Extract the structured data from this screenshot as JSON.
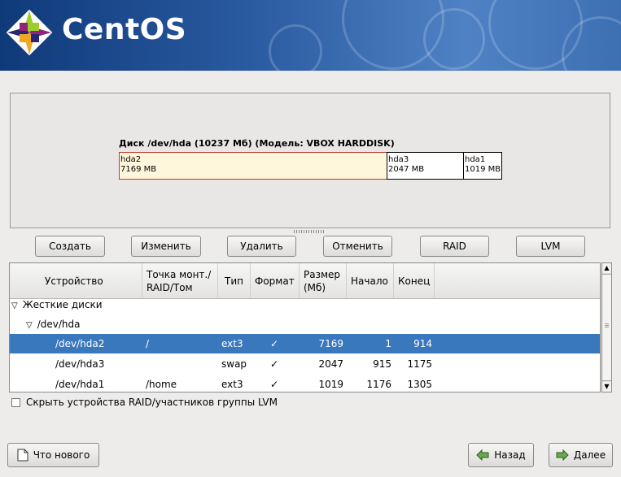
{
  "header": {
    "brand": "CentOS"
  },
  "disk": {
    "title": "Диск /dev/hda (10237 Мб) (Модель: VBOX HARDDISK)",
    "segments": [
      {
        "name": "hda2",
        "size": "7169 MB"
      },
      {
        "name": "hda3",
        "size": "2047 MB"
      },
      {
        "name": "hda1",
        "size": "1019 MB"
      }
    ]
  },
  "actions": {
    "create": "Создать",
    "edit": "Изменить",
    "delete": "Удалить",
    "cancel": "Отменить",
    "raid": "RAID",
    "lvm": "LVM"
  },
  "table": {
    "columns": {
      "device": "Устройство",
      "mount_line1": "Точка монт./",
      "mount_line2": "RAID/Том",
      "type": "Тип",
      "format": "Формат",
      "size_line1": "Размер",
      "size_line2": "(Мб)",
      "start": "Начало",
      "end": "Конец"
    },
    "group": "Жесткие диски",
    "disk": "/dev/hda",
    "rows": [
      {
        "device": "/dev/hda2",
        "mount": "/",
        "type": "ext3",
        "format": "✓",
        "size": "7169",
        "start": "1",
        "end": "914"
      },
      {
        "device": "/dev/hda3",
        "mount": "",
        "type": "swap",
        "format": "✓",
        "size": "2047",
        "start": "915",
        "end": "1175"
      },
      {
        "device": "/dev/hda1",
        "mount": "/home",
        "type": "ext3",
        "format": "✓",
        "size": "1019",
        "start": "1176",
        "end": "1305"
      }
    ]
  },
  "hide_raid_label": "Скрыть устройства RAID/участников группы LVM",
  "footer": {
    "whats_new": "Что нового",
    "back": "Назад",
    "next": "Далее"
  }
}
